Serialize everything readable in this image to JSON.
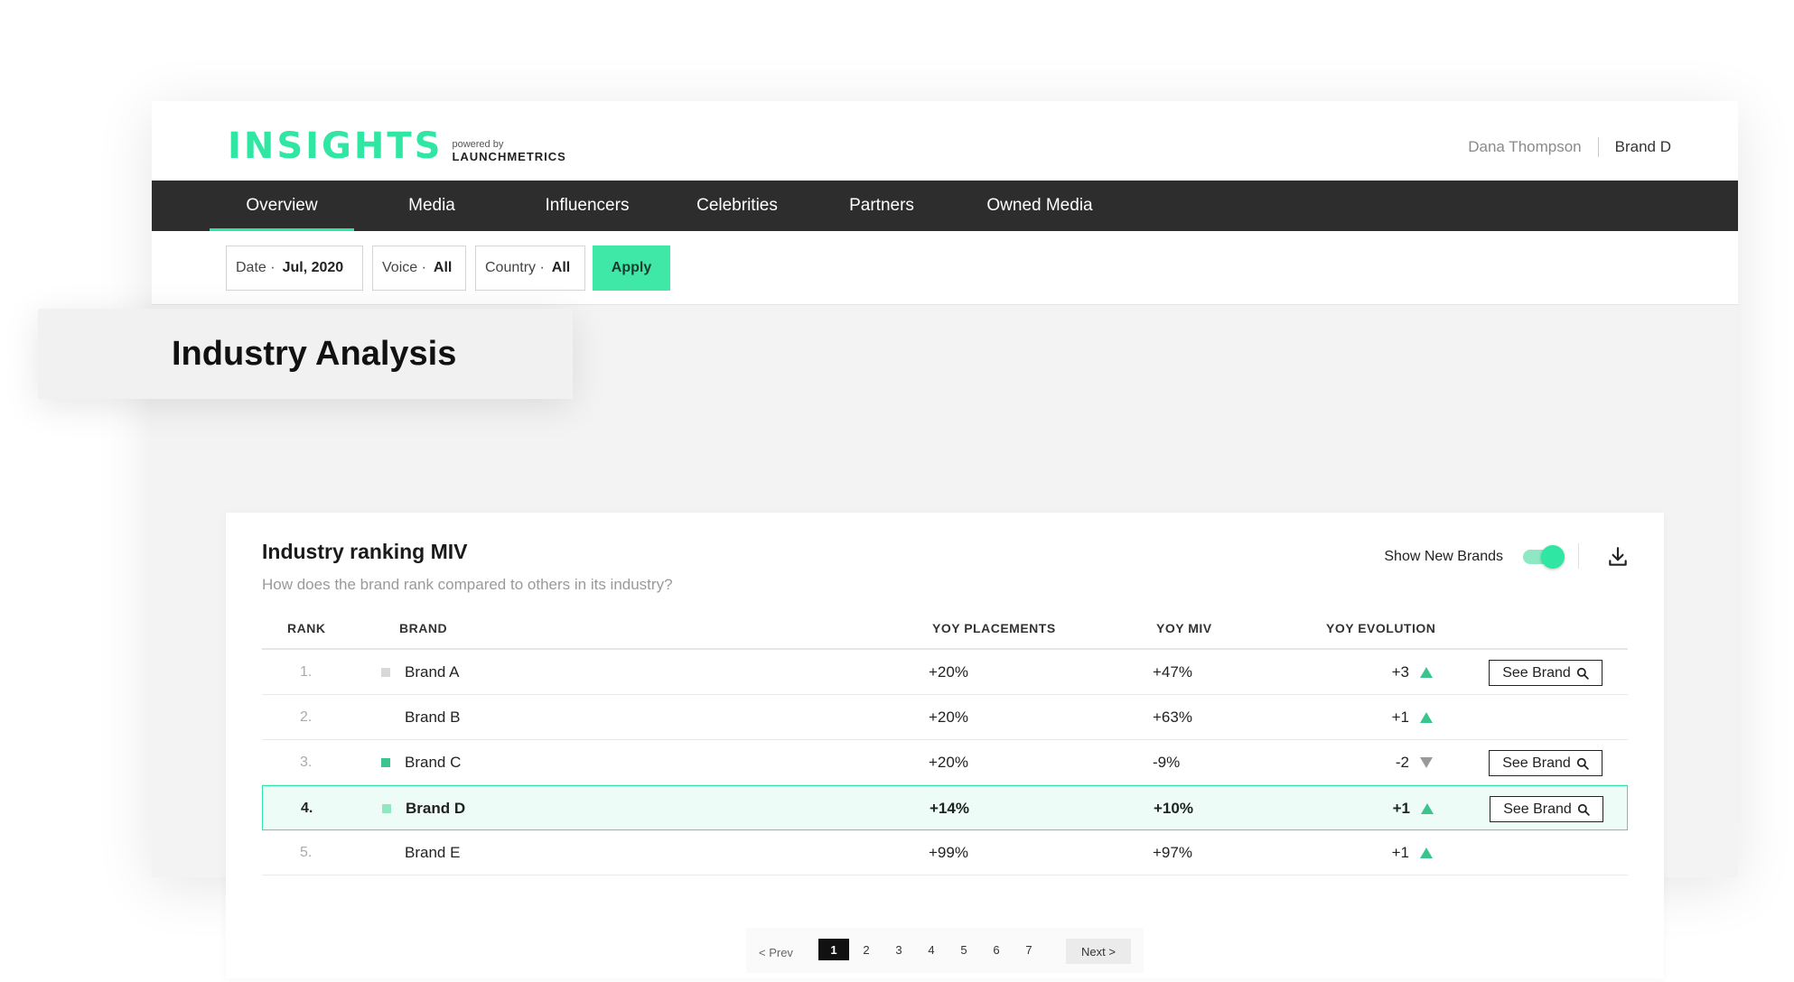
{
  "header": {
    "logo_word": "INSIGHTS",
    "logo_powered": "powered by",
    "logo_brand": "LAUNCHMETRICS",
    "user_name": "Dana Thompson",
    "user_brand": "Brand D"
  },
  "nav": {
    "items": [
      {
        "label": "Overview",
        "active": true
      },
      {
        "label": "Media"
      },
      {
        "label": "Influencers"
      },
      {
        "label": "Celebrities"
      },
      {
        "label": "Partners"
      },
      {
        "label": "Owned Media"
      }
    ]
  },
  "filters": {
    "date": {
      "label": "Date ·",
      "value": "Jul, 2020"
    },
    "voice": {
      "label": "Voice ·",
      "value": "All"
    },
    "country": {
      "label": "Country ·",
      "value": "All"
    },
    "apply_label": "Apply"
  },
  "section_title": "Industry Analysis",
  "card": {
    "title": "Industry ranking MIV",
    "subtitle": "How does the brand rank compared to others in its industry?",
    "toggle_label": "Show New Brands",
    "toggle_on": true
  },
  "table": {
    "columns": [
      "RANK",
      "BRAND",
      "YOY PLACEMENTS",
      "YOY MIV",
      "YOY EVOLUTION"
    ],
    "see_brand_label": "See Brand",
    "rows": [
      {
        "rank": "1.",
        "brand": "Brand A",
        "placements": "+20%",
        "miv": "+47%",
        "evolution": "+3",
        "trend": "up",
        "swatch": "#d8d8d8",
        "see_brand": true
      },
      {
        "rank": "2.",
        "brand": "Brand B",
        "placements": "+20%",
        "miv": "+63%",
        "evolution": "+1",
        "trend": "up",
        "swatch": "",
        "see_brand": false
      },
      {
        "rank": "3.",
        "brand": "Brand C",
        "placements": "+20%",
        "miv": "-9%",
        "evolution": "-2",
        "trend": "down",
        "swatch": "#3cc48f",
        "see_brand": true
      },
      {
        "rank": "4.",
        "brand": "Brand D",
        "placements": "+14%",
        "miv": "+10%",
        "evolution": "+1",
        "trend": "up",
        "swatch": "#8fe8c2",
        "see_brand": true,
        "current": true
      },
      {
        "rank": "5.",
        "brand": "Brand E",
        "placements": "+99%",
        "miv": "+97%",
        "evolution": "+1",
        "trend": "up",
        "swatch": "",
        "see_brand": false
      }
    ]
  },
  "pagination": {
    "prev_label": "< Prev",
    "next_label": "Next >",
    "pages": [
      "1",
      "2",
      "3",
      "4",
      "5",
      "6",
      "7"
    ],
    "current": "1"
  },
  "colors": {
    "accent": "#2fe6a3",
    "up": "#3cc48f",
    "down": "#9a9a9a",
    "nav_bg": "#2d2d2d"
  }
}
